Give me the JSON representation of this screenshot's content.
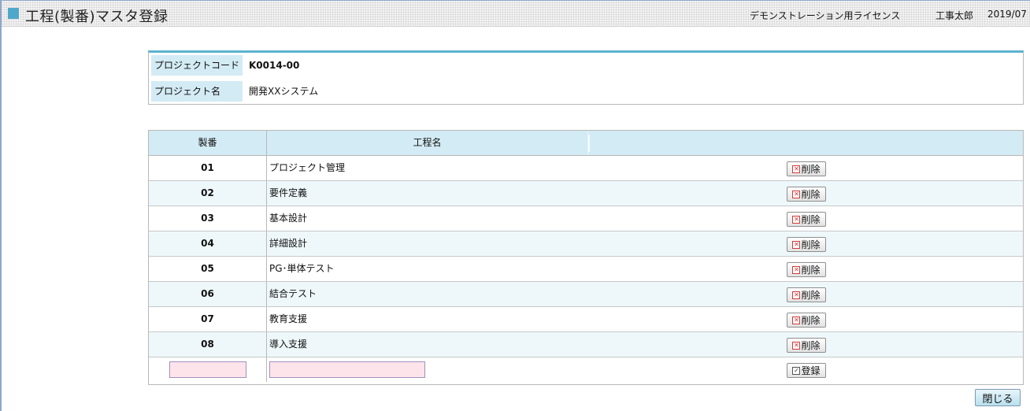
{
  "header": {
    "title": "工程(製番)マスタ登録",
    "license": "デモンストレーション用ライセンス",
    "user": "工事太郎",
    "date": "2019/07"
  },
  "project": {
    "code_label": "プロジェクトコード",
    "code_value": "K0014-00",
    "name_label": "プロジェクト名",
    "name_value": "開発XXシステム"
  },
  "table": {
    "col_no": "製番",
    "col_name": "工程名",
    "delete_label": "削除",
    "register_label": "登録",
    "rows": [
      {
        "no": "01",
        "name": "プロジェクト管理"
      },
      {
        "no": "02",
        "name": "要件定義"
      },
      {
        "no": "03",
        "name": "基本設計"
      },
      {
        "no": "04",
        "name": "詳細設計"
      },
      {
        "no": "05",
        "name": "PG･単体テスト"
      },
      {
        "no": "06",
        "name": "結合テスト"
      },
      {
        "no": "07",
        "name": "教育支援"
      },
      {
        "no": "08",
        "name": "導入支援"
      }
    ],
    "new_no_value": "",
    "new_name_value": ""
  },
  "footer": {
    "close_label": "閉じる"
  },
  "colors": {
    "accent": "#5cb3d0",
    "header_cell": "#d3ebf4",
    "alt_row": "#eef8fb",
    "input_bg": "#fde4ea",
    "delete_icon": "#d23a3a"
  },
  "icons": {
    "title": "square-icon",
    "delete": "x-box-icon",
    "register": "check-box-icon"
  }
}
